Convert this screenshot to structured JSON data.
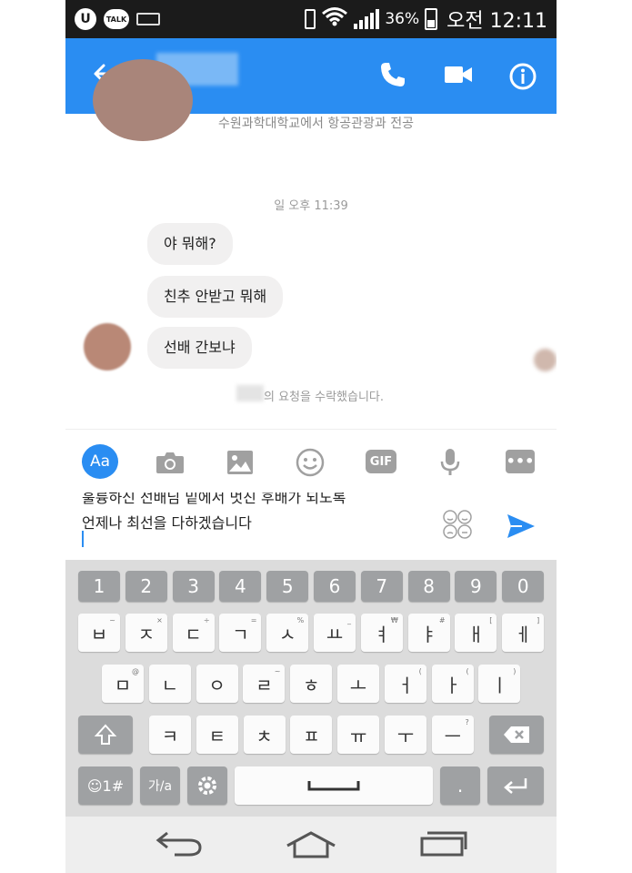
{
  "status_bar": {
    "u_badge": "U",
    "talk_badge": "TALK",
    "battery_percent": "36%",
    "time": "오전 12:11"
  },
  "header": {
    "back_icon": "arrow-left-icon",
    "call_icon": "phone-icon",
    "video_icon": "video-camera-icon",
    "info_icon": "info-icon"
  },
  "chat": {
    "profile_subtitle": "수원과학대학교에서 항공관광과 전공",
    "timestamp": "일 오후 11:39",
    "messages": [
      "야 뭐해?",
      "친추 안받고 뭐해",
      "선배 간보냐"
    ],
    "accept_notice": "의 요청을 수락했습니다."
  },
  "composer": {
    "aa_label": "Aa",
    "gif_label": "GIF",
    "more_label": "•••",
    "text_line1": "훌륭하신 선배님 밑에서 멋진 후배가 되도록",
    "text_line2": "언제나 최선을 다하겠습니다"
  },
  "keyboard": {
    "numbers": [
      "1",
      "2",
      "3",
      "4",
      "5",
      "6",
      "7",
      "8",
      "9",
      "0"
    ],
    "row1": [
      {
        "k": "ㅂ",
        "s": "~"
      },
      {
        "k": "ㅈ",
        "s": "×"
      },
      {
        "k": "ㄷ",
        "s": "÷"
      },
      {
        "k": "ㄱ",
        "s": "="
      },
      {
        "k": "ㅅ",
        "s": "%"
      },
      {
        "k": "ㅛ",
        "s": "_"
      },
      {
        "k": "ㅕ",
        "s": "₩"
      },
      {
        "k": "ㅑ",
        "s": "#"
      },
      {
        "k": "ㅐ",
        "s": "["
      },
      {
        "k": "ㅔ",
        "s": "]"
      }
    ],
    "row2": [
      {
        "k": "ㅁ",
        "s": "@"
      },
      {
        "k": "ㄴ",
        "s": ""
      },
      {
        "k": "ㅇ",
        "s": ""
      },
      {
        "k": "ㄹ",
        "s": "~"
      },
      {
        "k": "ㅎ",
        "s": ""
      },
      {
        "k": "ㅗ",
        "s": ""
      },
      {
        "k": "ㅓ",
        "s": "("
      },
      {
        "k": "ㅏ",
        "s": "("
      },
      {
        "k": "ㅣ",
        "s": ")"
      }
    ],
    "row3": [
      {
        "k": "ㅋ",
        "s": ""
      },
      {
        "k": "ㅌ",
        "s": ""
      },
      {
        "k": "ㅊ",
        "s": ""
      },
      {
        "k": "ㅍ",
        "s": ""
      },
      {
        "k": "ㅠ",
        "s": ""
      },
      {
        "k": "ㅜ",
        "s": ""
      },
      {
        "k": "ㅡ",
        "s": "?"
      }
    ],
    "emoji_num_label": "☺1#",
    "lang_label": "가/a",
    "period_label": "."
  },
  "navbar": {
    "back": "back-icon",
    "home": "home-icon",
    "recents": "recents-icon"
  },
  "colors": {
    "accent": "#2a8df2",
    "statusbar": "#1b1b1b",
    "bubble": "#f1f0f0",
    "keyboard_bg": "#dcdcdc"
  }
}
